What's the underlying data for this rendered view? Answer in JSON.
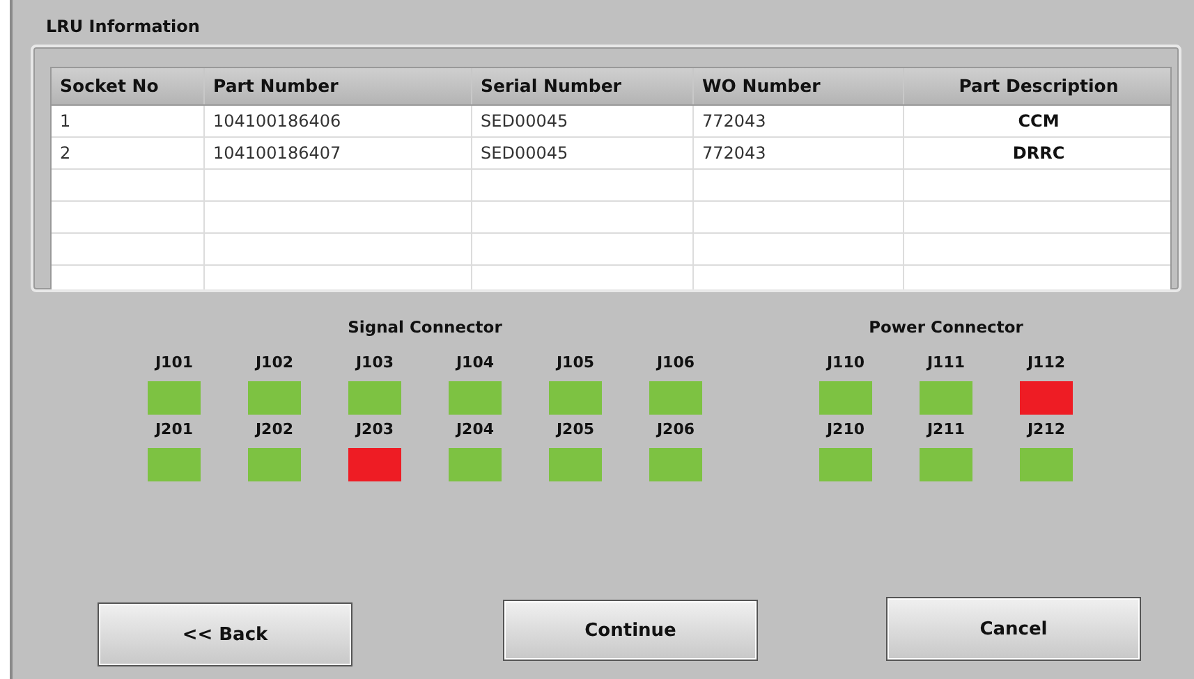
{
  "panel": {
    "title": "LRU Information"
  },
  "table": {
    "columns": [
      "Socket No",
      "Part Number",
      "Serial Number",
      "WO Number",
      "Part Description"
    ],
    "rows": [
      [
        "1",
        "104100186406",
        "SED00045",
        "772043",
        "CCM"
      ],
      [
        "2",
        "104100186407",
        "SED00045",
        "772043",
        "DRRC"
      ]
    ]
  },
  "connector_groups": [
    {
      "title": "Signal Connector",
      "rows": [
        [
          {
            "label": "J101",
            "color": "#7dc242"
          },
          {
            "label": "J102",
            "color": "#7dc242"
          },
          {
            "label": "J103",
            "color": "#7dc242"
          },
          {
            "label": "J104",
            "color": "#7dc242"
          },
          {
            "label": "J105",
            "color": "#7dc242"
          },
          {
            "label": "J106",
            "color": "#7dc242"
          }
        ],
        [
          {
            "label": "J201",
            "color": "#7dc242"
          },
          {
            "label": "J202",
            "color": "#7dc242"
          },
          {
            "label": "J203",
            "color": "#ee1c24"
          },
          {
            "label": "J204",
            "color": "#7dc242"
          },
          {
            "label": "J205",
            "color": "#7dc242"
          },
          {
            "label": "J206",
            "color": "#7dc242"
          }
        ]
      ]
    },
    {
      "title": "Power Connector",
      "rows": [
        [
          {
            "label": "J110",
            "color": "#7dc242"
          },
          {
            "label": "J111",
            "color": "#7dc242"
          },
          {
            "label": "J112",
            "color": "#ee1c24"
          }
        ],
        [
          {
            "label": "J210",
            "color": "#7dc242"
          },
          {
            "label": "J211",
            "color": "#7dc242"
          },
          {
            "label": "J212",
            "color": "#7dc242"
          }
        ]
      ]
    }
  ],
  "buttons": [
    "<< Back",
    "Continue",
    "Cancel"
  ]
}
